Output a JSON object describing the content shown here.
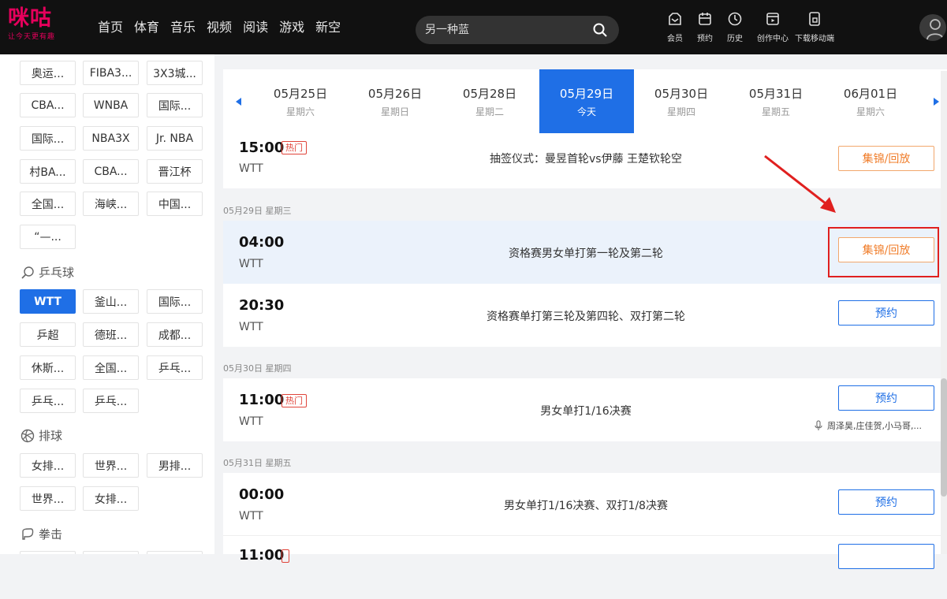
{
  "header": {
    "logo_text": "咪咕",
    "logo_slogan": "让今天更有趣",
    "nav": [
      "首页",
      "体育",
      "音乐",
      "视频",
      "阅读",
      "游戏",
      "新空"
    ],
    "search_placeholder": "另一种蓝",
    "tools": [
      {
        "label": "会员",
        "icon": "vip-icon"
      },
      {
        "label": "预约",
        "icon": "calendar-icon"
      },
      {
        "label": "历史",
        "icon": "clock-icon"
      },
      {
        "label": "创作中心",
        "icon": "play-box-icon"
      },
      {
        "label": "下载移动端",
        "icon": "download-icon"
      }
    ]
  },
  "sidebar": {
    "row0": [
      "奥运...",
      "FIBA3...",
      "3X3城..."
    ],
    "row1": [
      "CBA...",
      "WNBA",
      "国际..."
    ],
    "row2": [
      "国际...",
      "NBA3X",
      "Jr. NBA"
    ],
    "row3": [
      "村BA...",
      "CBA...",
      "晋江杯"
    ],
    "row4": [
      "全国...",
      "海峡...",
      "中国..."
    ],
    "row5": [
      "“—..."
    ],
    "pingpong_title": "乒乓球",
    "pp_row0": [
      "WTT",
      "釜山...",
      "国际..."
    ],
    "pp_row1": [
      "乒超",
      "德班...",
      "成都..."
    ],
    "pp_row2": [
      "休斯...",
      "全国...",
      "乒乓..."
    ],
    "pp_row3": [
      "乒乓...",
      "乒乓..."
    ],
    "volleyball_title": "排球",
    "vb_row0": [
      "女排...",
      "世界...",
      "男排..."
    ],
    "vb_row1": [
      "世界...",
      "女排..."
    ],
    "boxing_title": "拳击"
  },
  "dates": [
    {
      "d": "05月25日",
      "w": "星期六"
    },
    {
      "d": "05月26日",
      "w": "星期日"
    },
    {
      "d": "05月28日",
      "w": "星期二"
    },
    {
      "d": "05月29日",
      "w": "今天"
    },
    {
      "d": "05月30日",
      "w": "星期四"
    },
    {
      "d": "05月31日",
      "w": "星期五"
    },
    {
      "d": "06月01日",
      "w": "星期六"
    }
  ],
  "schedule": {
    "prev": {
      "time": "15:00",
      "hot": "热门",
      "league": "WTT",
      "title": "抽签仪式：曼昱首轮vs伊藤 王楚钦轮空",
      "button": "集锦/回放"
    },
    "g1_label": "05月29日 星期三",
    "g1": [
      {
        "time": "04:00",
        "league": "WTT",
        "title": "资格赛男女单打第一轮及第二轮",
        "button": "集锦/回放"
      },
      {
        "time": "20:30",
        "league": "WTT",
        "title": "资格赛单打第三轮及第四轮、双打第二轮",
        "button": "预约"
      }
    ],
    "g2_label": "05月30日 星期四",
    "g2": [
      {
        "time": "11:00",
        "hot": "热门",
        "league": "WTT",
        "title": "男女单打1/16决赛",
        "button": "预约",
        "commentator": "周泽昊,庄佳贺,小马哥,..."
      }
    ],
    "g3_label": "05月31日 星期五",
    "g3": [
      {
        "time": "00:00",
        "league": "WTT",
        "title": "男女单打1/16决赛、双打1/8决赛",
        "button": "预约"
      },
      {
        "time": "11:00"
      }
    ]
  },
  "colors": {
    "accent": "#1f6fe6",
    "brand": "#e6005c",
    "replay": "#f07d2a",
    "annotation": "#e0201f"
  }
}
